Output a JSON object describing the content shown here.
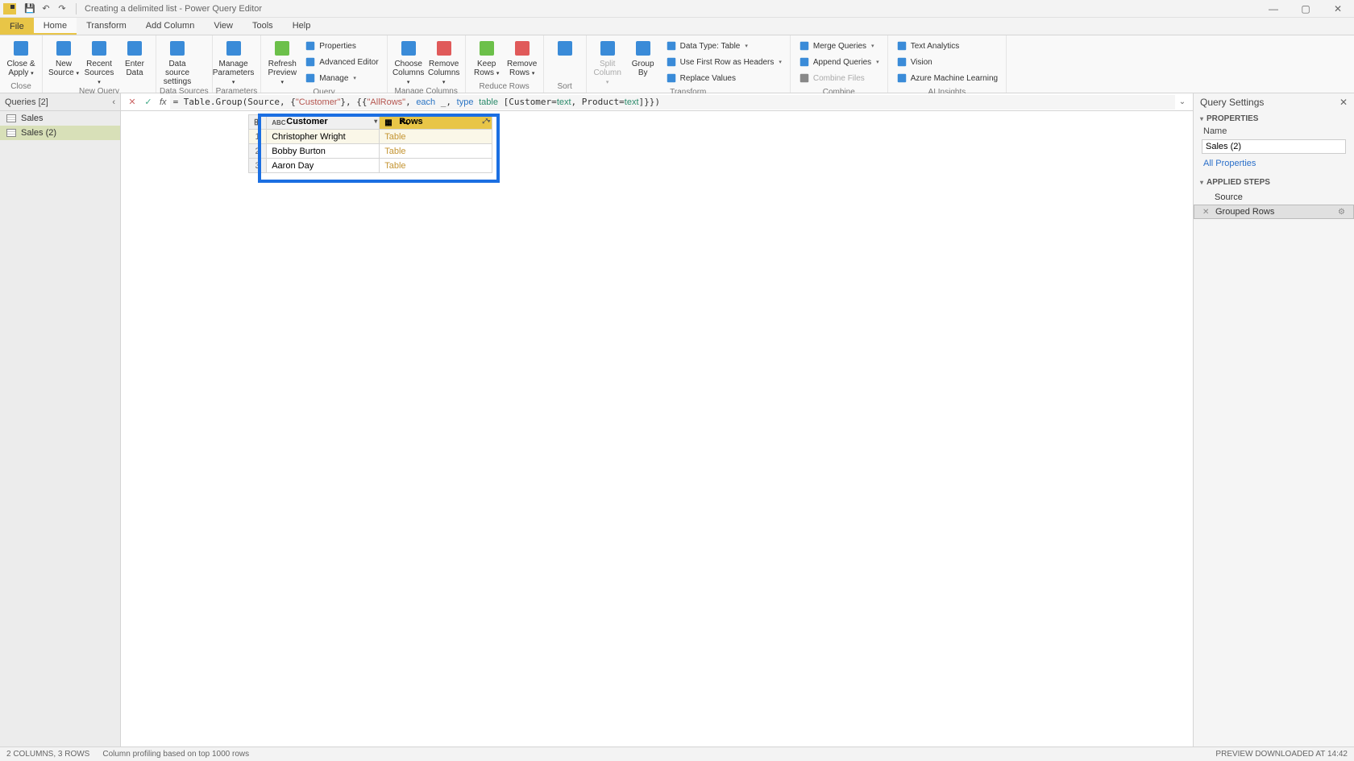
{
  "title": "Creating a delimited list - Power Query Editor",
  "menu": {
    "file": "File",
    "tabs": [
      "Home",
      "Transform",
      "Add Column",
      "View",
      "Tools",
      "Help"
    ],
    "active": 0
  },
  "ribbon": {
    "groups": [
      {
        "label": "Close",
        "items": [
          {
            "kind": "large",
            "text": "Close &\nApply",
            "icon": "close-apply",
            "dd": true
          }
        ]
      },
      {
        "label": "New Query",
        "items": [
          {
            "kind": "large",
            "text": "New\nSource",
            "icon": "new-source",
            "dd": true
          },
          {
            "kind": "large",
            "text": "Recent\nSources",
            "icon": "recent",
            "dd": true
          },
          {
            "kind": "large",
            "text": "Enter\nData",
            "icon": "enter-data"
          }
        ]
      },
      {
        "label": "Data Sources",
        "items": [
          {
            "kind": "large",
            "text": "Data source\nsettings",
            "icon": "ds-settings"
          }
        ]
      },
      {
        "label": "Parameters",
        "items": [
          {
            "kind": "large",
            "text": "Manage\nParameters",
            "icon": "params",
            "dd": true
          }
        ]
      },
      {
        "label": "Query",
        "items": [
          {
            "kind": "large",
            "text": "Refresh\nPreview",
            "icon": "refresh",
            "dd": true
          },
          {
            "kind": "small-col",
            "rows": [
              {
                "text": "Properties",
                "icon": "props"
              },
              {
                "text": "Advanced Editor",
                "icon": "adv"
              },
              {
                "text": "Manage",
                "icon": "manage",
                "dd": true
              }
            ]
          }
        ]
      },
      {
        "label": "Manage Columns",
        "items": [
          {
            "kind": "large",
            "text": "Choose\nColumns",
            "icon": "choose-cols",
            "dd": true
          },
          {
            "kind": "large",
            "text": "Remove\nColumns",
            "icon": "remove-cols",
            "dd": true
          }
        ]
      },
      {
        "label": "Reduce Rows",
        "items": [
          {
            "kind": "large",
            "text": "Keep\nRows",
            "icon": "keep-rows",
            "dd": true
          },
          {
            "kind": "large",
            "text": "Remove\nRows",
            "icon": "remove-rows",
            "dd": true
          }
        ]
      },
      {
        "label": "Sort",
        "items": [
          {
            "kind": "large",
            "text": "",
            "icon": "sort"
          }
        ]
      },
      {
        "label": "Transform",
        "items": [
          {
            "kind": "large",
            "text": "Split\nColumn",
            "icon": "split",
            "dd": true,
            "dim": true
          },
          {
            "kind": "large",
            "text": "Group\nBy",
            "icon": "group"
          },
          {
            "kind": "small-col",
            "rows": [
              {
                "text": "Data Type: Table",
                "icon": "dtype",
                "dd": true
              },
              {
                "text": "Use First Row as Headers",
                "icon": "headers",
                "dd": true
              },
              {
                "text": "Replace Values",
                "icon": "replace"
              }
            ]
          }
        ]
      },
      {
        "label": "Combine",
        "items": [
          {
            "kind": "small-col",
            "rows": [
              {
                "text": "Merge Queries",
                "icon": "merge",
                "dd": true
              },
              {
                "text": "Append Queries",
                "icon": "append",
                "dd": true
              },
              {
                "text": "Combine Files",
                "icon": "combine",
                "dim": true
              }
            ]
          }
        ]
      },
      {
        "label": "AI Insights",
        "items": [
          {
            "kind": "small-col",
            "rows": [
              {
                "text": "Text Analytics",
                "icon": "text-an"
              },
              {
                "text": "Vision",
                "icon": "vision"
              },
              {
                "text": "Azure Machine Learning",
                "icon": "aml"
              }
            ]
          }
        ]
      }
    ]
  },
  "queries": {
    "header": "Queries [2]",
    "items": [
      {
        "name": "Sales",
        "selected": false
      },
      {
        "name": "Sales (2)",
        "selected": true
      }
    ]
  },
  "formula": {
    "prefix": "= Table.Group(Source, {",
    "s1": "\"Customer\"",
    "mid1": "}, {{",
    "s2": "\"AllRows\"",
    "mid2": ", ",
    "kw1": "each",
    "mid3": " _, ",
    "kw2": "type",
    "mid4": " ",
    "ty1": "table",
    "mid5": " [Customer=",
    "ty2": "text",
    "mid6": ", Product=",
    "ty3": "text",
    "suffix": "]}})"
  },
  "grid": {
    "columns": [
      {
        "name": "Customer",
        "type": "ABC"
      },
      {
        "name": "AllRows",
        "type": "table",
        "selected": true,
        "displayed": "Rows"
      }
    ],
    "rows": [
      {
        "c0": "Christopher Wright",
        "c1": "Table",
        "sel": true
      },
      {
        "c0": "Bobby Burton",
        "c1": "Table"
      },
      {
        "c0": "Aaron Day",
        "c1": "Table"
      }
    ]
  },
  "settings": {
    "title": "Query Settings",
    "properties": {
      "label": "PROPERTIES",
      "nameLabel": "Name",
      "nameValue": "Sales (2)",
      "allProps": "All Properties"
    },
    "steps": {
      "label": "APPLIED STEPS",
      "items": [
        {
          "name": "Source"
        },
        {
          "name": "Grouped Rows",
          "selected": true,
          "gear": true
        }
      ]
    }
  },
  "status": {
    "left1": "2 COLUMNS, 3 ROWS",
    "left2": "Column profiling based on top 1000 rows",
    "right": "PREVIEW DOWNLOADED AT 14:42"
  }
}
